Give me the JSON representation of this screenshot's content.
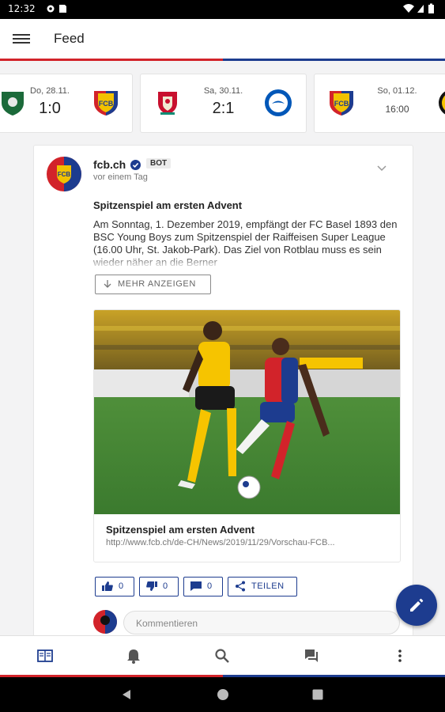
{
  "status_bar": {
    "time": "12:32"
  },
  "app_bar": {
    "title": "Feed"
  },
  "colors": {
    "accent_blue": "#1d3c8f",
    "accent_red": "#d2232a"
  },
  "matches": [
    {
      "date": "Do, 28.11.",
      "score": "1:0",
      "home": "team-crest",
      "away": "fcb-crest"
    },
    {
      "date": "Sa, 30.11.",
      "score": "2:1",
      "home": "liverpool-crest",
      "away": "brighton-crest"
    },
    {
      "date": "So, 01.12.",
      "score": "16:00",
      "home": "fcb-crest",
      "away": "yb-crest"
    }
  ],
  "post": {
    "author": "fcb.ch",
    "badge": "BOT",
    "time_ago": "vor einem Tag",
    "title": "Spitzenspiel am ersten Advent",
    "body": "Am Sonntag, 1. Dezember 2019, empfängt der FC Basel 1893 den BSC Young Boys zum Spitzenspiel der Raiffeisen Super League (16.00 Uhr, St. Jakob-Park). Das Ziel von Rotblau muss es sein wieder näher an die Berner",
    "more_label": "MEHR ANZEIGEN",
    "link": {
      "title": "Spitzenspiel am ersten Advent",
      "url": "http://www.fcb.ch/de-CH/News/2019/11/29/Vorschau-FCB..."
    },
    "actions": {
      "like_count": "0",
      "dislike_count": "0",
      "comment_count": "0",
      "share_label": "TEILEN"
    },
    "comment_placeholder": "Kommentieren"
  }
}
